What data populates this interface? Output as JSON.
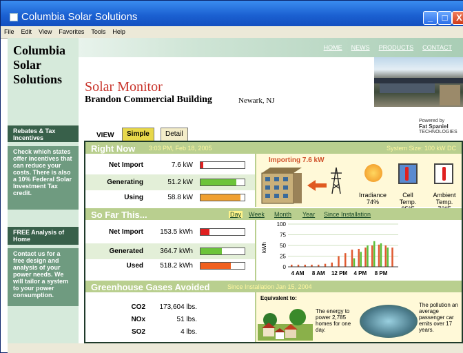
{
  "window": {
    "title": "Columbia Solar Solutions",
    "min": "_",
    "max": "□",
    "close": "X"
  },
  "menu": [
    "File",
    "Edit",
    "View",
    "Favorites",
    "Tools",
    "Help"
  ],
  "sidebar": {
    "brand": [
      "Columbia",
      "Solar",
      "Solutions"
    ],
    "box1": {
      "head": "Rebates & Tax Incentives",
      "text": "Check which states offer incentives that can reduce your costs. There is also a 10% Federal Solar Investment Tax credit."
    },
    "box2": {
      "head": "FREE Analysis of Home",
      "text": "Contact us for a free design and analysis of your power needs. We will tailor a system to your power consumption."
    }
  },
  "nav": [
    "HOME",
    "NEWS",
    "PRODUCTS",
    "CONTACT"
  ],
  "header": {
    "title": "Solar Monitor",
    "building": "Brandon Commercial Building",
    "location": "Newark, NJ"
  },
  "powered": {
    "l1": "Powered by",
    "l2": "Fat Spaniel",
    "l3": "TECHNOLOGIES"
  },
  "view": {
    "label": "VIEW",
    "tabs": [
      "Simple",
      "Detail"
    ]
  },
  "right_now": {
    "title": "Right Now",
    "time": "3:03 PM, Feb 18, 2005",
    "system_size": "System Size: 100 kW DC",
    "rows": [
      {
        "label": "Net Import",
        "value": "7.6 kW",
        "level": 0.07,
        "color": "#e02020"
      },
      {
        "label": "Generating",
        "value": "51.2 kW",
        "level": 0.82,
        "color": "#6cc43a"
      },
      {
        "label": "Using",
        "value": "58.8 kW",
        "level": 0.9,
        "color": "#f0a030"
      }
    ],
    "importing": "Importing 7.6 kW",
    "sensors": [
      {
        "label": "Irradiance",
        "value": "74%"
      },
      {
        "label": "Cell Temp.",
        "value": "85°F"
      },
      {
        "label": "Ambient Temp.",
        "value": "72°F"
      }
    ]
  },
  "so_far": {
    "title": "So Far This...",
    "periods": [
      "Day",
      "Week",
      "Month",
      "Year",
      "Since Installation"
    ],
    "rows": [
      {
        "label": "Net Import",
        "value": "153.5 kWh",
        "level": 0.2,
        "color": "#e02020"
      },
      {
        "label": "Generated",
        "value": "364.7 kWh",
        "level": 0.48,
        "color": "#6cc43a"
      },
      {
        "label": "Used",
        "value": "518.2 kWh",
        "level": 0.68,
        "color": "#f06020"
      }
    ]
  },
  "chart_data": {
    "type": "bar",
    "ylabel": "kWh",
    "yticks": [
      0,
      25,
      50,
      75,
      100
    ],
    "ylim": [
      0,
      100
    ],
    "xticks": [
      "4 AM",
      "8 AM",
      "12 PM",
      "4 PM",
      "8 PM"
    ],
    "series": [
      {
        "name": "",
        "values": [
          5,
          5,
          5,
          5,
          5,
          7,
          10,
          25,
          32,
          40,
          42,
          45,
          50,
          52,
          50,
          45
        ]
      },
      {
        "name": "",
        "values": [
          0,
          0,
          0,
          0,
          0,
          0,
          0,
          0,
          0,
          20,
          35,
          50,
          60,
          55,
          45,
          0
        ]
      }
    ]
  },
  "ghg": {
    "title": "Greenhouse Gases Avoided",
    "since": "Since Installation Jan 15, 2004",
    "rows": [
      {
        "label": "CO2",
        "value": "173,604 lbs."
      },
      {
        "label": "NOx",
        "value": "51 lbs."
      },
      {
        "label": "SO2",
        "value": "4 lbs."
      }
    ],
    "equiv_title": "Equivalent to:",
    "equiv1": "The energy to power 2,785 homes for one day.",
    "equiv2": "The pollution an average passenger car emits over 17 years."
  }
}
